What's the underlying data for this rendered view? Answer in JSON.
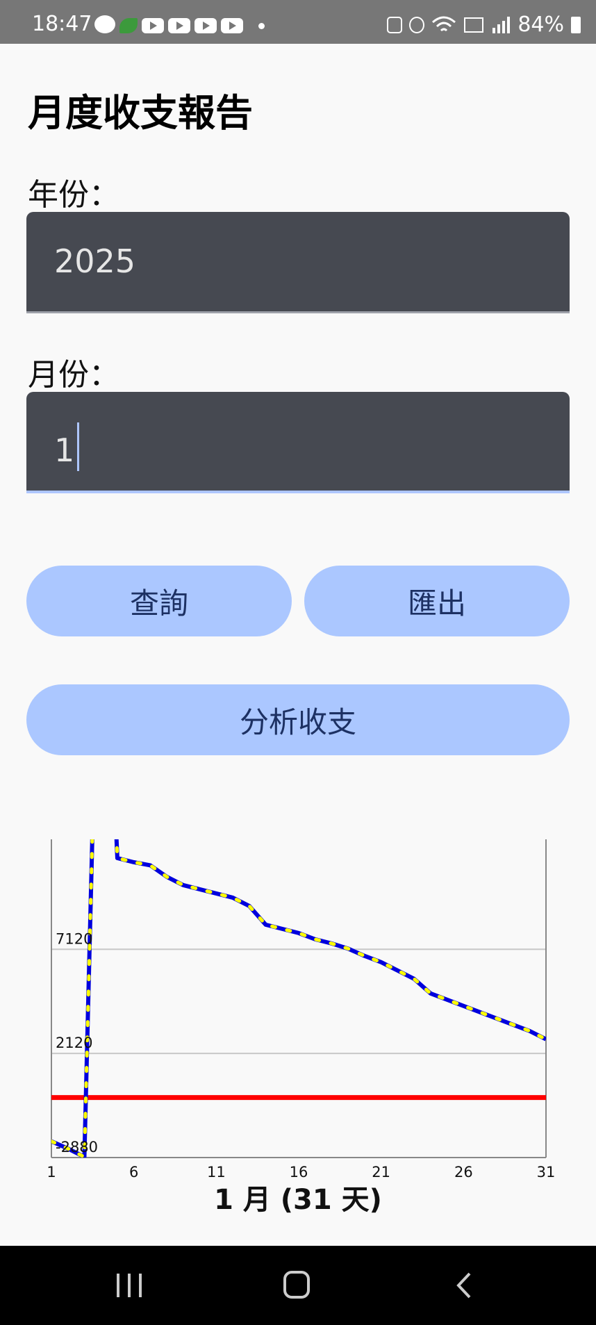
{
  "status_bar": {
    "time": "18:47",
    "notification_icons": [
      "line-icon",
      "leaf-app-icon",
      "youtube-icon",
      "youtube-icon",
      "youtube-icon",
      "youtube-icon"
    ],
    "system_icons": [
      "battery-saver-icon",
      "alarm-icon",
      "wifi-icon",
      "volte-icon",
      "signal-icon"
    ],
    "battery": "84%"
  },
  "page": {
    "title": "月度收支報告"
  },
  "form": {
    "year_label": "年份：",
    "year_value": "2025",
    "month_label": "月份：",
    "month_value": "1"
  },
  "buttons": {
    "query": "查詢",
    "export": "匯出",
    "analyze": "分析收支"
  },
  "chart_data": {
    "type": "line",
    "title": "1 月 (31 天)",
    "x_ticks": [
      "1",
      "6",
      "11",
      "16",
      "21",
      "26",
      "31"
    ],
    "y_ticks": [
      "7120",
      "2120",
      "-2880"
    ],
    "ylim": [
      -2880,
      12400
    ],
    "xlim": [
      1,
      31
    ],
    "x": [
      1,
      2,
      3,
      4,
      5,
      6,
      7,
      8,
      9,
      10,
      11,
      12,
      13,
      14,
      15,
      16,
      17,
      18,
      19,
      20,
      21,
      22,
      23,
      24,
      25,
      26,
      27,
      28,
      29,
      30,
      31
    ],
    "series": [
      {
        "values": [
          -2100,
          -2450,
          -2850,
          29000,
          11500,
          11300,
          11150,
          10600,
          10200,
          10000,
          9800,
          9600,
          9200,
          8300,
          8100,
          7900,
          7600,
          7400,
          7150,
          6800,
          6500,
          6100,
          5700,
          5000,
          4700,
          4400,
          4100,
          3800,
          3500,
          3200,
          2800
        ],
        "color": "#0000dd",
        "marker_color": "#ffff00"
      }
    ],
    "reference_line": {
      "value": 0,
      "color": "#ff0000"
    },
    "grid": true
  },
  "colors": {
    "status_bar": "#777777",
    "background": "#f9f9f9",
    "input_bg": "#464951",
    "button_bg": "#abc7ff",
    "button_text": "#1d3163",
    "focus_accent": "#aec6ff",
    "nav_bar": "#000000"
  },
  "nav_bar": {
    "items": [
      "recent-apps-icon",
      "home-icon",
      "back-icon"
    ]
  }
}
